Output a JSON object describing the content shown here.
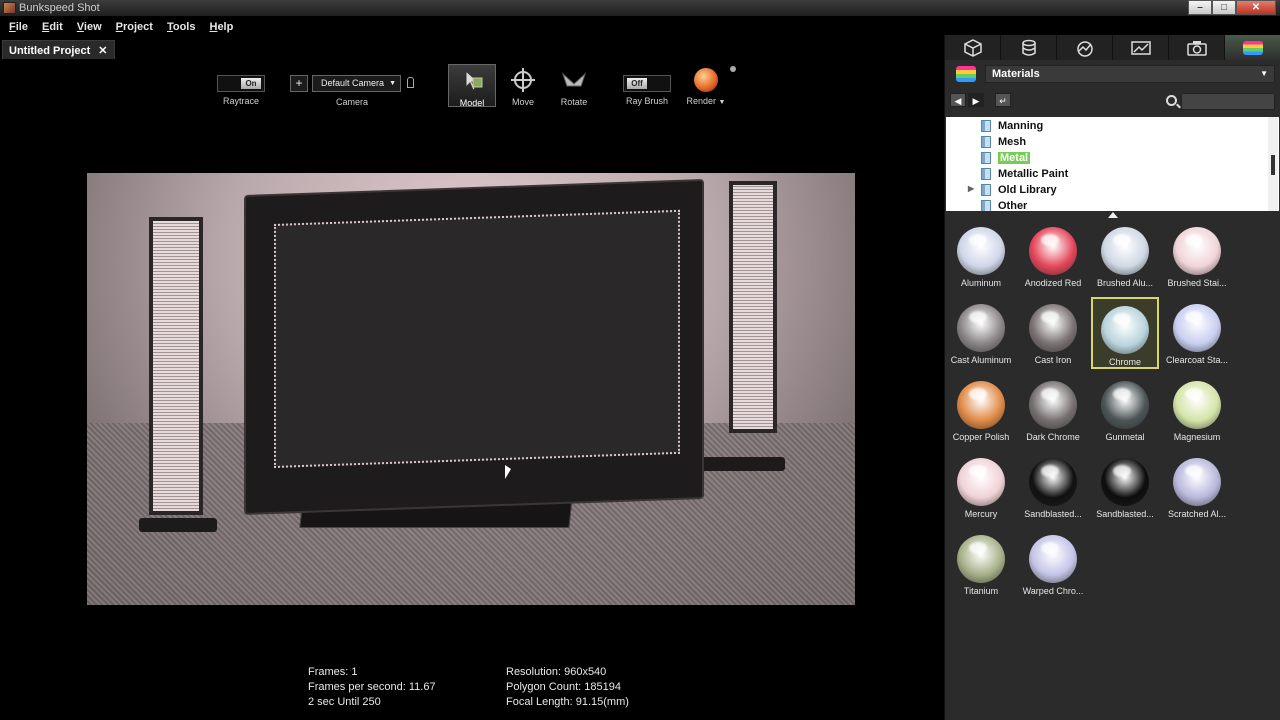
{
  "window": {
    "title": "Bunkspeed Shot",
    "controls": [
      "–",
      "□",
      "✕"
    ]
  },
  "menu": [
    "File",
    "Edit",
    "View",
    "Project",
    "Tools",
    "Help"
  ],
  "document_tab": {
    "label": "Untitled Project",
    "close": "✕"
  },
  "toolbar": {
    "raytrace": {
      "state": "On",
      "label": "Raytrace"
    },
    "camera": {
      "add": "+",
      "selected": "Default Camera",
      "label": "Camera"
    },
    "tools": [
      {
        "label": "Model",
        "icon": "model-cursor-icon",
        "active": true
      },
      {
        "label": "Move",
        "icon": "move-icon"
      },
      {
        "label": "Rotate",
        "icon": "rotate-icon"
      }
    ],
    "ray_brush": {
      "state": "Off",
      "label": "Ray Brush"
    },
    "render": {
      "label": "Render",
      "icon": "render-sphere-icon"
    }
  },
  "stats": {
    "left": [
      "Frames: 1",
      "Frames per second: 11.67",
      "2 sec Until 250"
    ],
    "right": [
      "Resolution: 960x540",
      "Polygon Count: 185194",
      "Focal Length: 91.15(mm)"
    ]
  },
  "panel": {
    "tabs": [
      {
        "icon": "cube-icon"
      },
      {
        "icon": "database-icon"
      },
      {
        "icon": "gauge-icon"
      },
      {
        "icon": "chart-icon"
      },
      {
        "icon": "camera-icon"
      },
      {
        "icon": "materials-stack-icon",
        "active": true
      }
    ],
    "library_select": "Materials",
    "search": {
      "value": "",
      "placeholder": ""
    },
    "tree": [
      {
        "label": "Manning"
      },
      {
        "label": "Mesh"
      },
      {
        "label": "Metal",
        "selected": true
      },
      {
        "label": "Metallic Paint"
      },
      {
        "label": "Old Library",
        "expandable": true
      },
      {
        "label": "Other"
      }
    ],
    "materials": [
      {
        "name": "Aluminum",
        "color": "#cfd6e8"
      },
      {
        "name": "Anodized Red",
        "color": "#e4465a"
      },
      {
        "name": "Brushed Alu...",
        "color": "#cfd8e4"
      },
      {
        "name": "Brushed Stai...",
        "color": "#f1d4d8"
      },
      {
        "name": "Cast Aluminum",
        "color": "#8a8586"
      },
      {
        "name": "Cast Iron",
        "color": "#7a7273"
      },
      {
        "name": "Chrome",
        "color": "#b8d4dc",
        "selected": true
      },
      {
        "name": "Clearcoat Sta...",
        "color": "#c8cff0"
      },
      {
        "name": "Copper Polish",
        "color": "#e08a46"
      },
      {
        "name": "Dark Chrome",
        "color": "#777071"
      },
      {
        "name": "Gunmetal",
        "color": "#4c5556"
      },
      {
        "name": "Magnesium",
        "color": "#d4e4a8"
      },
      {
        "name": "Mercury",
        "color": "#f0d2d6"
      },
      {
        "name": "Sandblasted...",
        "color": "#111111"
      },
      {
        "name": "Sandblasted...",
        "color": "#0d0d0d"
      },
      {
        "name": "Scratched Al...",
        "color": "#b8b8dc"
      },
      {
        "name": "Titanium",
        "color": "#a6b088"
      },
      {
        "name": "Warped Chro...",
        "color": "#c4c4e8"
      }
    ]
  }
}
